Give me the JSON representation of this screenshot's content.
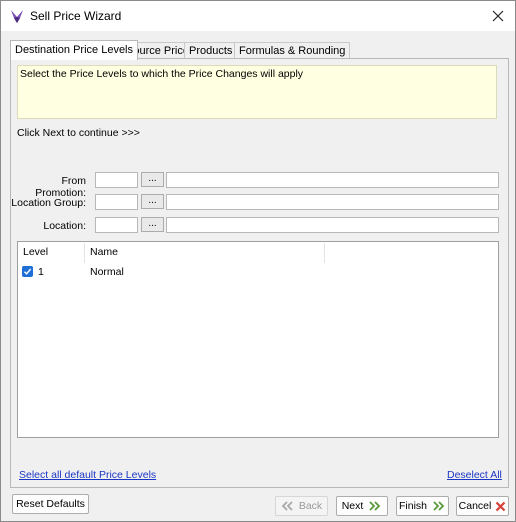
{
  "window": {
    "title": "Sell Price Wizard",
    "accent": "#1f6fd6",
    "link_color": "#1a36c4"
  },
  "icons": {
    "app": "wizard-icon",
    "close": "close-icon",
    "next": "double-chevron-right-icon",
    "back": "double-chevron-left-icon",
    "cancel": "cancel-x-icon"
  },
  "tabs": [
    {
      "label": "Destination Price Levels",
      "active": true
    },
    {
      "label": "Source Price",
      "active": false
    },
    {
      "label": "Products",
      "active": false
    },
    {
      "label": "Formulas & Rounding",
      "active": false
    }
  ],
  "panel": {
    "note": "Select the Price Levels to which the Price Changes will apply",
    "click_next": "Click  Next to continue >>>",
    "fields": [
      {
        "label": "From Promotion:",
        "code": "",
        "browse": "...",
        "description": ""
      },
      {
        "label": "Location Group:",
        "code": "",
        "browse": "...",
        "description": ""
      },
      {
        "label": "Location:",
        "code": "",
        "browse": "...",
        "description": ""
      }
    ],
    "grid": {
      "columns": [
        "Level",
        "Name"
      ],
      "rows": [
        {
          "checked": true,
          "level": "1",
          "name": "Normal"
        }
      ]
    },
    "select_all_link": "Select all default Price Levels",
    "deselect_all_link": "Deselect All"
  },
  "footer": {
    "reset_label": "Reset Defaults",
    "back_label": "Back",
    "next_label": "Next",
    "finish_label": "Finish",
    "cancel_label": "Cancel"
  }
}
